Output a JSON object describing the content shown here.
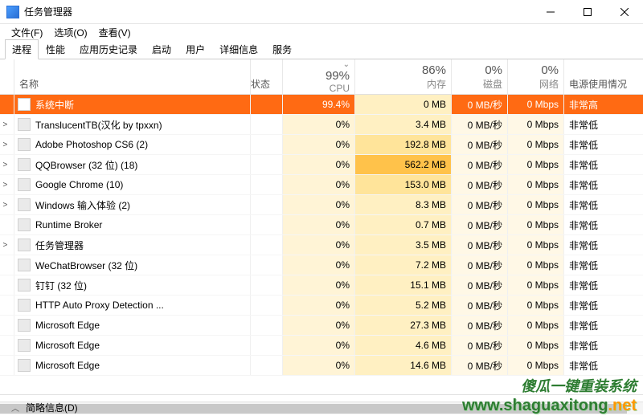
{
  "window": {
    "title": "任务管理器"
  },
  "menu": {
    "file": "文件(F)",
    "options": "选项(O)",
    "view": "查看(V)"
  },
  "tabs": [
    "进程",
    "性能",
    "应用历史记录",
    "启动",
    "用户",
    "详细信息",
    "服务"
  ],
  "columns": {
    "name": "名称",
    "status": "状态",
    "cpu_pct": "99%",
    "cpu_lbl": "CPU",
    "mem_pct": "86%",
    "mem_lbl": "内存",
    "disk_pct": "0%",
    "disk_lbl": "磁盘",
    "net_pct": "0%",
    "net_lbl": "网络",
    "power_lbl": "电源使用情况"
  },
  "rows": [
    {
      "expand": "",
      "name": "系统中断",
      "cpu": "99.4%",
      "cpu_cls": "heat-cpu-99",
      "mem": "0 MB",
      "mem_cls": "heat-mem-lo",
      "disk": "0 MB/秒",
      "net": "0 Mbps",
      "power": "非常高",
      "hot": true
    },
    {
      "expand": ">",
      "name": "TranslucentTB(汉化 by tpxxn)",
      "cpu": "0%",
      "cpu_cls": "heat-cpu-0",
      "mem": "3.4 MB",
      "mem_cls": "heat-mem-lo",
      "disk": "0 MB/秒",
      "net": "0 Mbps",
      "power": "非常低"
    },
    {
      "expand": ">",
      "name": "Adobe Photoshop CS6 (2)",
      "cpu": "0%",
      "cpu_cls": "heat-cpu-0",
      "mem": "192.8 MB",
      "mem_cls": "heat-mem-md",
      "disk": "0 MB/秒",
      "net": "0 Mbps",
      "power": "非常低"
    },
    {
      "expand": ">",
      "name": "QQBrowser (32 位) (18)",
      "cpu": "0%",
      "cpu_cls": "heat-cpu-0",
      "mem": "562.2 MB",
      "mem_cls": "heat-mem-hi",
      "disk": "0 MB/秒",
      "net": "0 Mbps",
      "power": "非常低"
    },
    {
      "expand": ">",
      "name": "Google Chrome (10)",
      "cpu": "0%",
      "cpu_cls": "heat-cpu-0",
      "mem": "153.0 MB",
      "mem_cls": "heat-mem-md",
      "disk": "0 MB/秒",
      "net": "0 Mbps",
      "power": "非常低"
    },
    {
      "expand": ">",
      "name": "Windows 输入体验 (2)",
      "cpu": "0%",
      "cpu_cls": "heat-cpu-0",
      "mem": "8.3 MB",
      "mem_cls": "heat-mem-lo",
      "disk": "0 MB/秒",
      "net": "0 Mbps",
      "power": "非常低"
    },
    {
      "expand": "",
      "name": "Runtime Broker",
      "cpu": "0%",
      "cpu_cls": "heat-cpu-0",
      "mem": "0.7 MB",
      "mem_cls": "heat-mem-lo",
      "disk": "0 MB/秒",
      "net": "0 Mbps",
      "power": "非常低"
    },
    {
      "expand": ">",
      "name": "任务管理器",
      "cpu": "0%",
      "cpu_cls": "heat-cpu-0",
      "mem": "3.5 MB",
      "mem_cls": "heat-mem-lo",
      "disk": "0 MB/秒",
      "net": "0 Mbps",
      "power": "非常低"
    },
    {
      "expand": "",
      "name": "WeChatBrowser (32 位)",
      "cpu": "0%",
      "cpu_cls": "heat-cpu-0",
      "mem": "7.2 MB",
      "mem_cls": "heat-mem-lo",
      "disk": "0 MB/秒",
      "net": "0 Mbps",
      "power": "非常低"
    },
    {
      "expand": "",
      "name": "钉钉 (32 位)",
      "cpu": "0%",
      "cpu_cls": "heat-cpu-0",
      "mem": "15.1 MB",
      "mem_cls": "heat-mem-lo",
      "disk": "0 MB/秒",
      "net": "0 Mbps",
      "power": "非常低"
    },
    {
      "expand": "",
      "name": "HTTP Auto Proxy Detection ...",
      "cpu": "0%",
      "cpu_cls": "heat-cpu-0",
      "mem": "5.2 MB",
      "mem_cls": "heat-mem-lo",
      "disk": "0 MB/秒",
      "net": "0 Mbps",
      "power": "非常低"
    },
    {
      "expand": "",
      "name": "Microsoft Edge",
      "cpu": "0%",
      "cpu_cls": "heat-cpu-0",
      "mem": "27.3 MB",
      "mem_cls": "heat-mem-lo",
      "disk": "0 MB/秒",
      "net": "0 Mbps",
      "power": "非常低"
    },
    {
      "expand": "",
      "name": "Microsoft Edge",
      "cpu": "0%",
      "cpu_cls": "heat-cpu-0",
      "mem": "4.6 MB",
      "mem_cls": "heat-mem-lo",
      "disk": "0 MB/秒",
      "net": "0 Mbps",
      "power": "非常低"
    },
    {
      "expand": "",
      "name": "Microsoft Edge",
      "cpu": "0%",
      "cpu_cls": "heat-cpu-0",
      "mem": "14.6 MB",
      "mem_cls": "heat-mem-lo",
      "disk": "0 MB/秒",
      "net": "0 Mbps",
      "power": "非常低"
    }
  ],
  "footer": {
    "label": "简略信息(D)"
  },
  "watermark": {
    "line1": "傻瓜一键重装系统",
    "line2_a": "www.",
    "line2_b": "shaguaxitong",
    "line2_c": ".net"
  }
}
